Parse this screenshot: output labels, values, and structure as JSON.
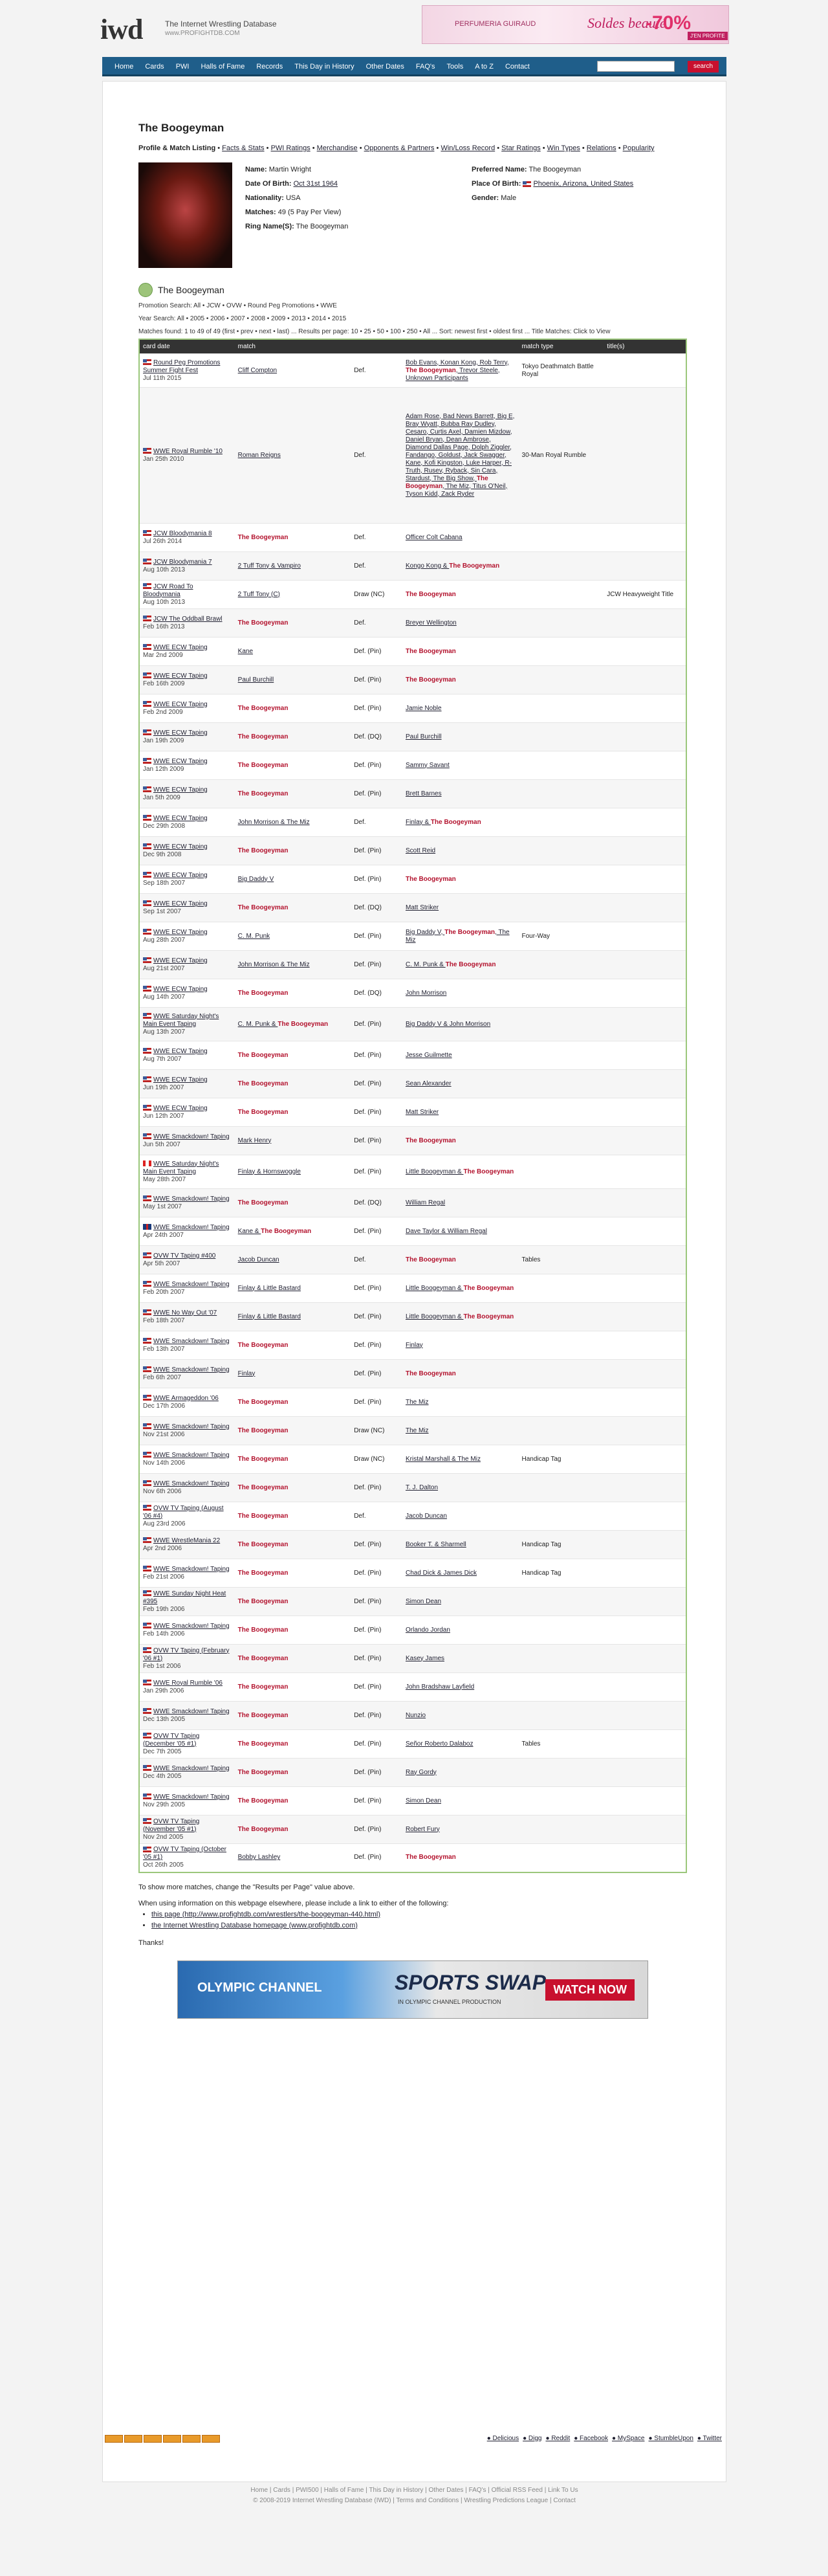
{
  "site": {
    "logo": "iwd",
    "name": "The Internet Wrestling Database",
    "url": "www.PROFIGHTDB.COM"
  },
  "ad_top": {
    "brand": "PERFUMERIA GUIRAUD",
    "headline": "Soldes beauté",
    "percent": "-70%",
    "cta": "J'EN PROFITE"
  },
  "nav": {
    "items": [
      "Home",
      "Cards",
      "PWI",
      "Halls of Fame",
      "Records",
      "This Day in History",
      "Other Dates",
      "FAQ's",
      "Tools",
      "A to Z",
      "Contact"
    ],
    "search_button": "search"
  },
  "page": {
    "title": "The Boogeyman",
    "links_label": "Profile & Match Listing",
    "links": [
      "Facts & Stats",
      "PWI Ratings",
      "Merchandise",
      "Opponents & Partners",
      "Win/Loss Record",
      "Star Ratings",
      "Win Types",
      "Relations",
      "Popularity"
    ]
  },
  "profile": {
    "name_label": "Name:",
    "name": "Martin Wright",
    "dob_label": "Date Of Birth:",
    "dob": "Oct 31st 1964",
    "nationality_label": "Nationality:",
    "nationality": "USA",
    "matches_label": "Matches:",
    "matches": "49 (5 Pay Per View)",
    "ring_label": "Ring Name(S):",
    "ring": "The Boogeyman",
    "pref_label": "Preferred Name:",
    "pref": "The Boogeyman",
    "pob_label": "Place Of Birth:",
    "pob": "Phoenix, Arizona, United States",
    "gender_label": "Gender:",
    "gender": "Male"
  },
  "section": {
    "title": "The Boogeyman",
    "promotion_search": "Promotion Search: All • JCW • OVW • Round Peg Promotions • WWE",
    "year_search": "Year Search: All • 2005 • 2006 • 2007 • 2008 • 2009 • 2013 • 2014 • 2015",
    "matches_found": "Matches found: 1 to 49 of 49 (first • prev • next • last) ... Results per page: 10 • 25 • 50 • 100 • 250 • All ... Sort: newest first • oldest first ... Title Matches: Click to View"
  },
  "table": {
    "headers": [
      "card date",
      "match",
      "",
      "",
      "match type",
      "title(s)"
    ],
    "rows": [
      {
        "card": "Round Peg Promotions Summer Fight Fest",
        "date": "Jul 11th 2015",
        "w": "Cliff Compton",
        "r": "Def.",
        "l": "Bob Evans, Konan Kong, Rob Terry, The Boogeyman, Trevor Steele, Unknown Participants",
        "type": "Tokyo Deathmatch Battle Royal",
        "title": "",
        "flag": "us"
      },
      {
        "card": "WWE Royal Rumble '10",
        "date": "Jan 25th 2010",
        "w": "Roman Reigns",
        "r": "Def.",
        "l": "Adam Rose, Bad News Barrett, Big E, Bray Wyatt, Bubba Ray Dudley, Cesaro, Curtis Axel, Damien Mizdow, Daniel Bryan, Dean Ambrose, Diamond Dallas Page, Dolph Ziggler, Fandango, Goldust, Jack Swagger, Kane, Kofi Kingston, Luke Harper, R-Truth, Rusev, Ryback, Sin Cara, Stardust, The Big Show, The Boogeyman, The Miz, Titus O'Neil, Tyson Kidd, Zack Ryder",
        "type": "30-Man Royal Rumble",
        "title": "",
        "flag": "us"
      },
      {
        "card": "JCW Bloodymania 8",
        "date": "Jul 26th 2014",
        "w": "The Boogeyman",
        "r": "Def.",
        "l": "Officer Colt Cabana",
        "type": "",
        "title": "",
        "flag": "us"
      },
      {
        "card": "JCW Bloodymania 7",
        "date": "Aug 10th 2013",
        "w": "2 Tuff Tony & Vampiro",
        "r": "Def.",
        "l": "Kongo Kong & The Boogeyman",
        "type": "",
        "title": "",
        "flag": "us"
      },
      {
        "card": "JCW Road To Bloodymania",
        "date": "Aug 10th 2013",
        "w": "2 Tuff Tony (C)",
        "r": "Draw (NC)",
        "l": "The Boogeyman",
        "type": "",
        "title": "JCW Heavyweight Title",
        "flag": "us"
      },
      {
        "card": "JCW The Oddball Brawl",
        "date": "Feb 16th 2013",
        "w": "The Boogeyman",
        "r": "Def.",
        "l": "Breyer Wellington",
        "type": "",
        "title": "",
        "flag": "us"
      },
      {
        "card": "WWE ECW Taping",
        "date": "Mar 2nd 2009",
        "w": "Kane",
        "r": "Def. (Pin)",
        "l": "The Boogeyman",
        "type": "",
        "title": "",
        "flag": "us"
      },
      {
        "card": "WWE ECW Taping",
        "date": "Feb 16th 2009",
        "w": "Paul Burchill",
        "r": "Def. (Pin)",
        "l": "The Boogeyman",
        "type": "",
        "title": "",
        "flag": "us"
      },
      {
        "card": "WWE ECW Taping",
        "date": "Feb 2nd 2009",
        "w": "The Boogeyman",
        "r": "Def. (Pin)",
        "l": "Jamie Noble",
        "type": "",
        "title": "",
        "flag": "us"
      },
      {
        "card": "WWE ECW Taping",
        "date": "Jan 19th 2009",
        "w": "The Boogeyman",
        "r": "Def. (DQ)",
        "l": "Paul Burchill",
        "type": "",
        "title": "",
        "flag": "us"
      },
      {
        "card": "WWE ECW Taping",
        "date": "Jan 12th 2009",
        "w": "The Boogeyman",
        "r": "Def. (Pin)",
        "l": "Sammy Savant",
        "type": "",
        "title": "",
        "flag": "us"
      },
      {
        "card": "WWE ECW Taping",
        "date": "Jan 5th 2009",
        "w": "The Boogeyman",
        "r": "Def. (Pin)",
        "l": "Brett Barnes",
        "type": "",
        "title": "",
        "flag": "us"
      },
      {
        "card": "WWE ECW Taping",
        "date": "Dec 29th 2008",
        "w": "John Morrison & The Miz",
        "r": "Def.",
        "l": "Finlay & The Boogeyman",
        "type": "",
        "title": "",
        "flag": "us"
      },
      {
        "card": "WWE ECW Taping",
        "date": "Dec 9th 2008",
        "w": "The Boogeyman",
        "r": "Def. (Pin)",
        "l": "Scott Reid",
        "type": "",
        "title": "",
        "flag": "us"
      },
      {
        "card": "WWE ECW Taping",
        "date": "Sep 18th 2007",
        "w": "Big Daddy V",
        "r": "Def. (Pin)",
        "l": "The Boogeyman",
        "type": "",
        "title": "",
        "flag": "us"
      },
      {
        "card": "WWE ECW Taping",
        "date": "Sep 1st 2007",
        "w": "The Boogeyman",
        "r": "Def. (DQ)",
        "l": "Matt Striker",
        "type": "",
        "title": "",
        "flag": "us"
      },
      {
        "card": "WWE ECW Taping",
        "date": "Aug 28th 2007",
        "w": "C. M. Punk",
        "r": "Def. (Pin)",
        "l": "Big Daddy V, The Boogeyman, The Miz",
        "type": "Four-Way",
        "title": "",
        "flag": "us"
      },
      {
        "card": "WWE ECW Taping",
        "date": "Aug 21st 2007",
        "w": "John Morrison & The Miz",
        "r": "Def. (Pin)",
        "l": "C. M. Punk & The Boogeyman",
        "type": "",
        "title": "",
        "flag": "us"
      },
      {
        "card": "WWE ECW Taping",
        "date": "Aug 14th 2007",
        "w": "The Boogeyman",
        "r": "Def. (DQ)",
        "l": "John Morrison",
        "type": "",
        "title": "",
        "flag": "us"
      },
      {
        "card": "WWE Saturday Night's Main Event Taping",
        "date": "Aug 13th 2007",
        "w": "C. M. Punk & The Boogeyman",
        "r": "Def. (Pin)",
        "l": "Big Daddy V & John Morrison",
        "type": "",
        "title": "",
        "flag": "us"
      },
      {
        "card": "WWE ECW Taping",
        "date": "Aug 7th 2007",
        "w": "The Boogeyman",
        "r": "Def. (Pin)",
        "l": "Jesse Guilmette",
        "type": "",
        "title": "",
        "flag": "us"
      },
      {
        "card": "WWE ECW Taping",
        "date": "Jun 19th 2007",
        "w": "The Boogeyman",
        "r": "Def. (Pin)",
        "l": "Sean Alexander",
        "type": "",
        "title": "",
        "flag": "us"
      },
      {
        "card": "WWE ECW Taping",
        "date": "Jun 12th 2007",
        "w": "The Boogeyman",
        "r": "Def. (Pin)",
        "l": "Matt Striker",
        "type": "",
        "title": "",
        "flag": "us"
      },
      {
        "card": "WWE Smackdown! Taping",
        "date": "Jun 5th 2007",
        "w": "Mark Henry",
        "r": "Def. (Pin)",
        "l": "The Boogeyman",
        "type": "",
        "title": "",
        "flag": "us"
      },
      {
        "card": "WWE Saturday Night's Main Event Taping",
        "date": "May 28th 2007",
        "w": "Finlay & Hornswoggle",
        "r": "Def. (Pin)",
        "l": "Little Boogeyman & The Boogeyman",
        "type": "",
        "title": "",
        "flag": "ca"
      },
      {
        "card": "WWE Smackdown! Taping",
        "date": "May 1st 2007",
        "w": "The Boogeyman",
        "r": "Def. (DQ)",
        "l": "William Regal",
        "type": "",
        "title": "",
        "flag": "us"
      },
      {
        "card": "WWE Smackdown! Taping",
        "date": "Apr 24th 2007",
        "w": "Kane & The Boogeyman",
        "r": "Def. (Pin)",
        "l": "Dave Taylor & William Regal",
        "type": "",
        "title": "",
        "flag": "uk"
      },
      {
        "card": "OVW TV Taping #400",
        "date": "Apr 5th 2007",
        "w": "Jacob Duncan",
        "r": "Def.",
        "l": "The Boogeyman",
        "type": "Tables",
        "title": "",
        "flag": "us"
      },
      {
        "card": "WWE Smackdown! Taping",
        "date": "Feb 20th 2007",
        "w": "Finlay & Little Bastard",
        "r": "Def. (Pin)",
        "l": "Little Boogeyman & The Boogeyman",
        "type": "",
        "title": "",
        "flag": "us"
      },
      {
        "card": "WWE No Way Out '07",
        "date": "Feb 18th 2007",
        "w": "Finlay & Little Bastard",
        "r": "Def. (Pin)",
        "l": "Little Boogeyman & The Boogeyman",
        "type": "",
        "title": "",
        "flag": "us"
      },
      {
        "card": "WWE Smackdown! Taping",
        "date": "Feb 13th 2007",
        "w": "The Boogeyman",
        "r": "Def. (Pin)",
        "l": "Finlay",
        "type": "",
        "title": "",
        "flag": "us"
      },
      {
        "card": "WWE Smackdown! Taping",
        "date": "Feb 6th 2007",
        "w": "Finlay",
        "r": "Def. (Pin)",
        "l": "The Boogeyman",
        "type": "",
        "title": "",
        "flag": "us"
      },
      {
        "card": "WWE Armageddon '06",
        "date": "Dec 17th 2006",
        "w": "The Boogeyman",
        "r": "Def. (Pin)",
        "l": "The Miz",
        "type": "",
        "title": "",
        "flag": "us"
      },
      {
        "card": "WWE Smackdown! Taping",
        "date": "Nov 21st 2006",
        "w": "The Boogeyman",
        "r": "Draw (NC)",
        "l": "The Miz",
        "type": "",
        "title": "",
        "flag": "us"
      },
      {
        "card": "WWE Smackdown! Taping",
        "date": "Nov 14th 2006",
        "w": "The Boogeyman",
        "r": "Draw (NC)",
        "l": "Kristal Marshall & The Miz",
        "type": "Handicap Tag",
        "title": "",
        "flag": "us"
      },
      {
        "card": "WWE Smackdown! Taping",
        "date": "Nov 6th 2006",
        "w": "The Boogeyman",
        "r": "Def. (Pin)",
        "l": "T. J. Dalton",
        "type": "",
        "title": "",
        "flag": "us"
      },
      {
        "card": "OVW TV Taping (August '06 #4)",
        "date": "Aug 23rd 2006",
        "w": "The Boogeyman",
        "r": "Def.",
        "l": "Jacob Duncan",
        "type": "",
        "title": "",
        "flag": "us"
      },
      {
        "card": "WWE WrestleMania 22",
        "date": "Apr 2nd 2006",
        "w": "The Boogeyman",
        "r": "Def. (Pin)",
        "l": "Booker T. & Sharmell",
        "type": "Handicap Tag",
        "title": "",
        "flag": "us"
      },
      {
        "card": "WWE Smackdown! Taping",
        "date": "Feb 21st 2006",
        "w": "The Boogeyman",
        "r": "Def. (Pin)",
        "l": "Chad Dick & James Dick",
        "type": "Handicap Tag",
        "title": "",
        "flag": "us"
      },
      {
        "card": "WWE Sunday Night Heat #395",
        "date": "Feb 19th 2006",
        "w": "The Boogeyman",
        "r": "Def. (Pin)",
        "l": "Simon Dean",
        "type": "",
        "title": "",
        "flag": "us"
      },
      {
        "card": "WWE Smackdown! Taping",
        "date": "Feb 14th 2006",
        "w": "The Boogeyman",
        "r": "Def. (Pin)",
        "l": "Orlando Jordan",
        "type": "",
        "title": "",
        "flag": "us"
      },
      {
        "card": "OVW TV Taping (February '06 #1)",
        "date": "Feb 1st 2006",
        "w": "The Boogeyman",
        "r": "Def. (Pin)",
        "l": "Kasey James",
        "type": "",
        "title": "",
        "flag": "us"
      },
      {
        "card": "WWE Royal Rumble '06",
        "date": "Jan 29th 2006",
        "w": "The Boogeyman",
        "r": "Def. (Pin)",
        "l": "John Bradshaw Layfield",
        "type": "",
        "title": "",
        "flag": "us"
      },
      {
        "card": "WWE Smackdown! Taping",
        "date": "Dec 13th 2005",
        "w": "The Boogeyman",
        "r": "Def. (Pin)",
        "l": "Nunzio",
        "type": "",
        "title": "",
        "flag": "us"
      },
      {
        "card": "OVW TV Taping (December '05 #1)",
        "date": "Dec 7th 2005",
        "w": "The Boogeyman",
        "r": "Def. (Pin)",
        "l": "Señor Roberto Dalaboz",
        "type": "Tables",
        "title": "",
        "flag": "us"
      },
      {
        "card": "WWE Smackdown! Taping",
        "date": "Dec 4th 2005",
        "w": "The Boogeyman",
        "r": "Def. (Pin)",
        "l": "Ray Gordy",
        "type": "",
        "title": "",
        "flag": "us"
      },
      {
        "card": "WWE Smackdown! Taping",
        "date": "Nov 29th 2005",
        "w": "The Boogeyman",
        "r": "Def. (Pin)",
        "l": "Simon Dean",
        "type": "",
        "title": "",
        "flag": "us"
      },
      {
        "card": "OVW TV Taping (November '05 #1)",
        "date": "Nov 2nd 2005",
        "w": "The Boogeyman",
        "r": "Def. (Pin)",
        "l": "Robert Fury",
        "type": "",
        "title": "",
        "flag": "us"
      },
      {
        "card": "OVW TV Taping (October '05 #1)",
        "date": "Oct 26th 2005",
        "w": "Bobby Lashley",
        "r": "Def. (Pin)",
        "l": "The Boogeyman",
        "type": "",
        "title": "",
        "flag": "us"
      }
    ]
  },
  "footnotes": {
    "more": "To show more matches, change the \"Results per Page\" value above.",
    "using": "When using information on this webpage elsewhere, please include a link to either of the following:",
    "link1": "this page (http://www.profightdb.com/wrestlers/the-boogeyman-440.html)",
    "link2": "the Internet Wrestling Database homepage (www.profightdb.com)",
    "thanks": "Thanks!"
  },
  "ad_bottom": {
    "left": "OLYMPIC CHANNEL",
    "brand": "SPORTS SWAP",
    "sub": "IN OLYMPIC CHANNEL PRODUCTION",
    "cta": "WATCH NOW"
  },
  "social": [
    "Delicious",
    "Digg",
    "Reddit",
    "Facebook",
    "MySpace",
    "StumbleUpon",
    "Twitter"
  ],
  "footer": {
    "links": "Home | Cards | PWI500 | Halls of Fame | This Day in History | Other Dates | FAQ's | Official RSS Feed | Link To Us",
    "copyright": "© 2008-2019 Internet Wrestling Database (IWD) | Terms and Conditions | Wrestling Predictions League | Contact"
  }
}
